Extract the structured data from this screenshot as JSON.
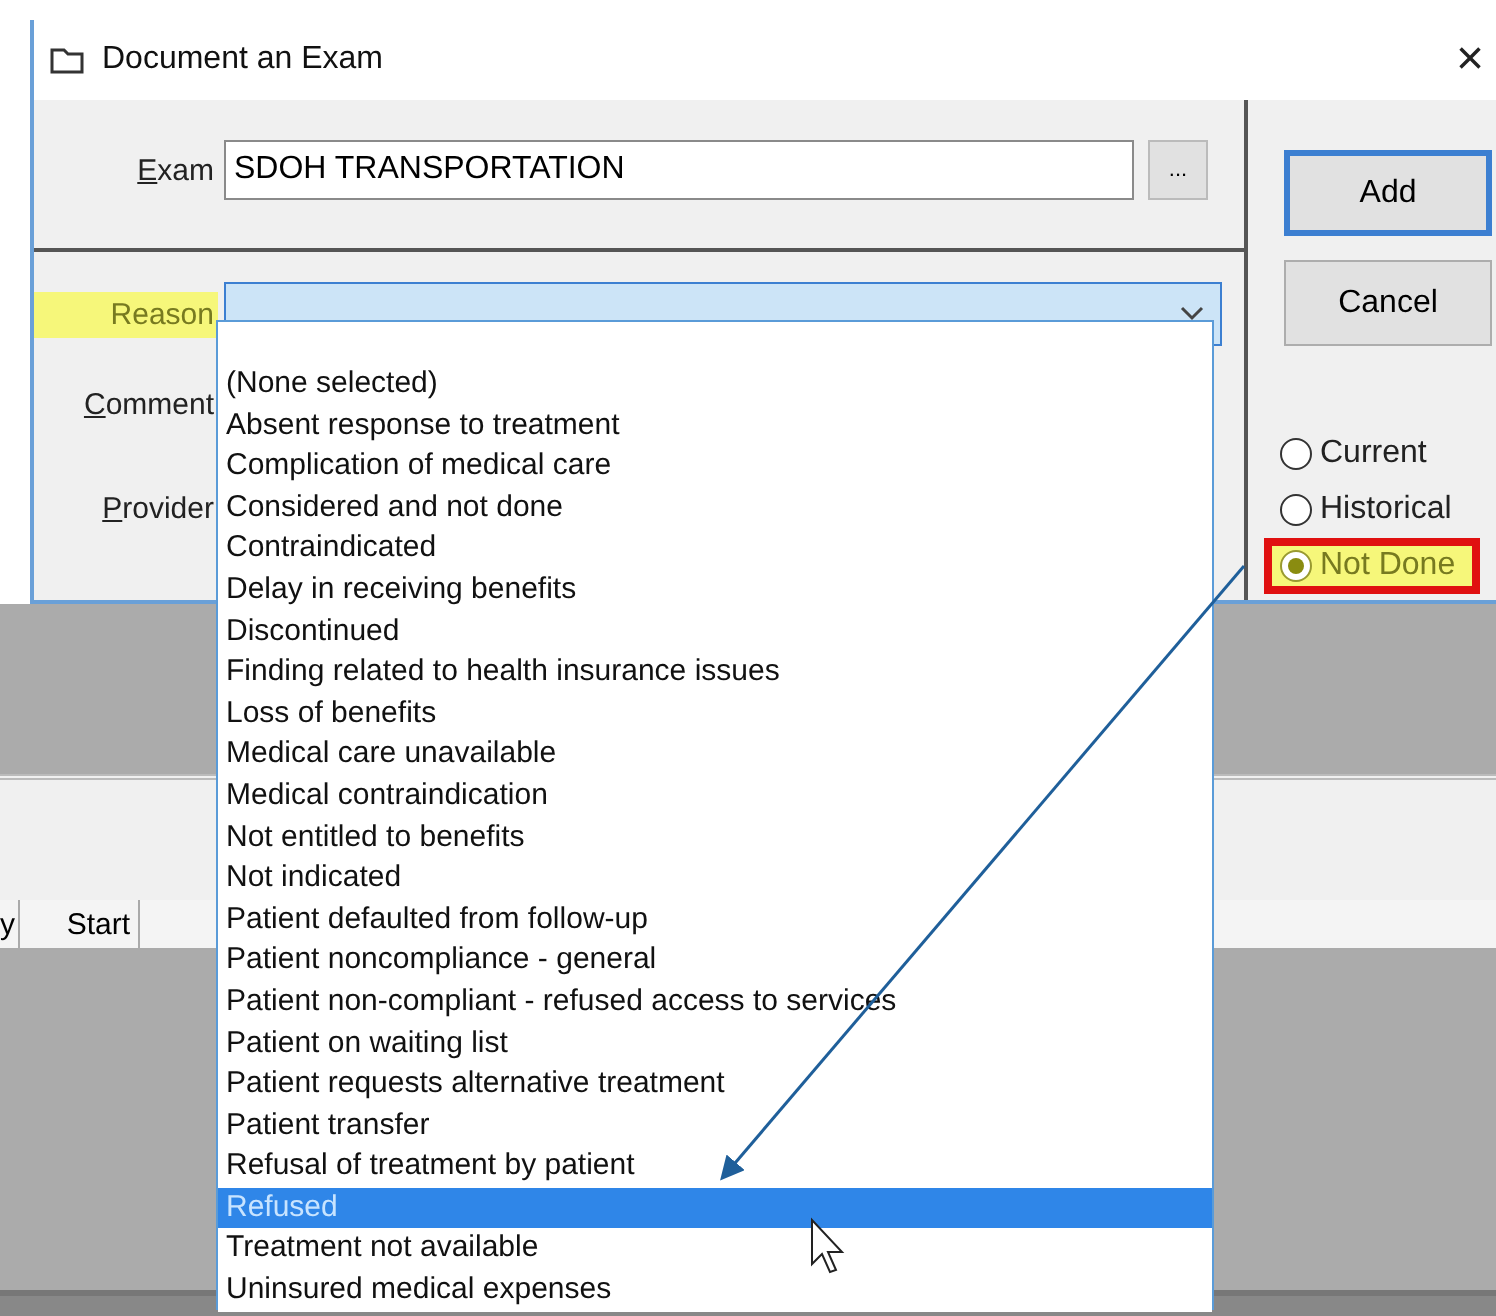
{
  "window": {
    "title": "Document an Exam",
    "close": "×"
  },
  "exam": {
    "label": "Exam",
    "value": "SDOH TRANSPORTATION",
    "browse": "..."
  },
  "reason": {
    "label": "Reason",
    "highlighted": true,
    "expanded": true,
    "options": [
      {
        "label": "(None selected)",
        "selected": false
      },
      {
        "label": "Absent response to treatment",
        "selected": false
      },
      {
        "label": "Complication of medical care",
        "selected": false
      },
      {
        "label": "Considered and not done",
        "selected": false
      },
      {
        "label": "Contraindicated",
        "selected": false
      },
      {
        "label": "Delay in receiving benefits",
        "selected": false
      },
      {
        "label": "Discontinued",
        "selected": false
      },
      {
        "label": "Finding related to health insurance issues",
        "selected": false
      },
      {
        "label": "Loss of benefits",
        "selected": false
      },
      {
        "label": "Medical care unavailable",
        "selected": false
      },
      {
        "label": "Medical contraindication",
        "selected": false
      },
      {
        "label": "Not entitled to benefits",
        "selected": false
      },
      {
        "label": "Not indicated",
        "selected": false
      },
      {
        "label": "Patient defaulted from follow-up",
        "selected": false
      },
      {
        "label": "Patient noncompliance - general",
        "selected": false
      },
      {
        "label": "Patient non-compliant - refused access to services",
        "selected": false
      },
      {
        "label": "Patient on waiting list",
        "selected": false
      },
      {
        "label": "Patient requests alternative treatment",
        "selected": false
      },
      {
        "label": "Patient transfer",
        "selected": false
      },
      {
        "label": "Refusal of treatment by patient",
        "selected": false
      },
      {
        "label": "Refused",
        "selected": true
      },
      {
        "label": "Treatment not available",
        "selected": false
      },
      {
        "label": "Uninsured medical expenses",
        "selected": false
      }
    ]
  },
  "comment": {
    "label": "Comment"
  },
  "provider": {
    "label": "Provider"
  },
  "buttons": [
    {
      "label": "Add",
      "default": true
    },
    {
      "label": "Cancel",
      "default": false
    }
  ],
  "status": [
    {
      "label": "Current",
      "selected": false,
      "highlighted": false
    },
    {
      "label": "Historical",
      "selected": false,
      "highlighted": false
    },
    {
      "label": "Not Done",
      "selected": true,
      "highlighted": true
    }
  ],
  "table": {
    "columns": [
      "y",
      "Start"
    ]
  }
}
